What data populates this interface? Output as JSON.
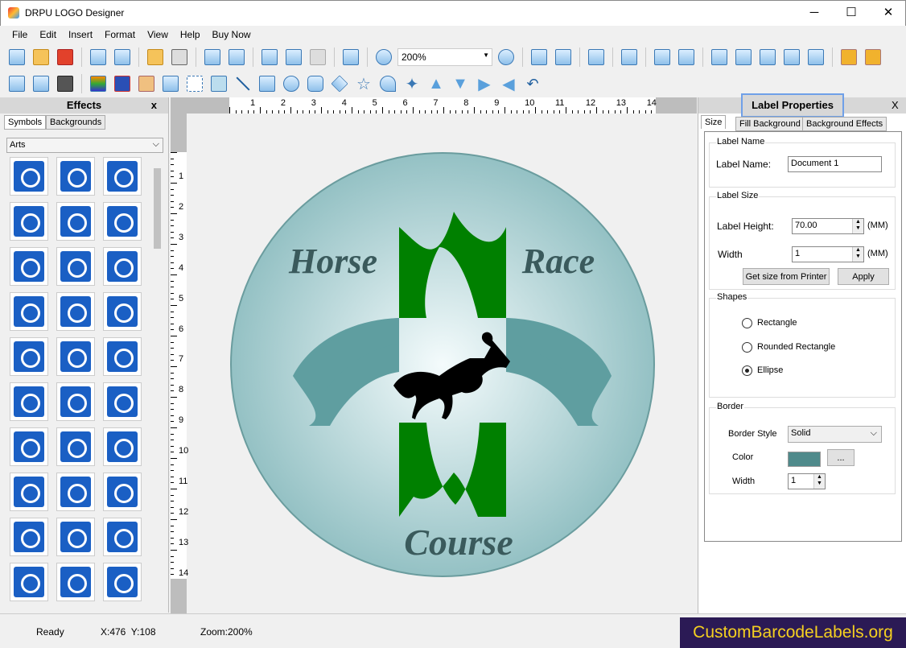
{
  "window": {
    "title": "DRPU LOGO Designer",
    "minimize": "─",
    "maximize": "☐",
    "close": "✕"
  },
  "menu": [
    "File",
    "Edit",
    "Insert",
    "Format",
    "View",
    "Help",
    "Buy Now"
  ],
  "toolbar": {
    "zoom_value": "200%"
  },
  "effects": {
    "title": "Effects",
    "close": "x",
    "tabs": [
      "Symbols",
      "Backgrounds"
    ],
    "category": "Arts"
  },
  "ruler": {
    "h": [
      "1",
      "2",
      "3",
      "4",
      "5",
      "6",
      "7",
      "8",
      "9",
      "10",
      "11",
      "12",
      "13",
      "14"
    ],
    "v": [
      "1",
      "2",
      "3",
      "4",
      "5",
      "6",
      "7",
      "8",
      "9",
      "10",
      "11",
      "12",
      "13",
      "14"
    ]
  },
  "logo": {
    "word1": "Horse",
    "word2": "Race",
    "word3": "Course",
    "colors": {
      "circle": "#a9d0d2",
      "green": "#008000",
      "teal": "#5f9ea0",
      "text": "#3a5a5c"
    }
  },
  "props": {
    "title": "Label Properties",
    "close": "X",
    "tabs": [
      "Size",
      "Fill Background",
      "Background Effects"
    ],
    "label_name_group": "Label Name",
    "label_name_label": "Label Name:",
    "label_name_value": "Document 1",
    "label_size_group": "Label Size",
    "height_label": "Label Height:",
    "height_value": "70.00",
    "width_label": "Width",
    "width_value": "1",
    "unit": "(MM)",
    "get_size_btn": "Get size from Printer",
    "apply_btn": "Apply",
    "shapes_group": "Shapes",
    "shapes": [
      "Rectangle",
      "Rounded Rectangle",
      "Ellipse"
    ],
    "selected_shape": "Ellipse",
    "border_group": "Border",
    "border_style_label": "Border Style",
    "border_style_value": "Solid",
    "color_label": "Color",
    "color_value": "#4f8a8b",
    "color_btn": "..."
  },
  "status": {
    "ready": "Ready",
    "coords": "X:476  Y:108",
    "zoom": "Zoom:200%",
    "brand": "CustomBarcodeLabels.org"
  }
}
